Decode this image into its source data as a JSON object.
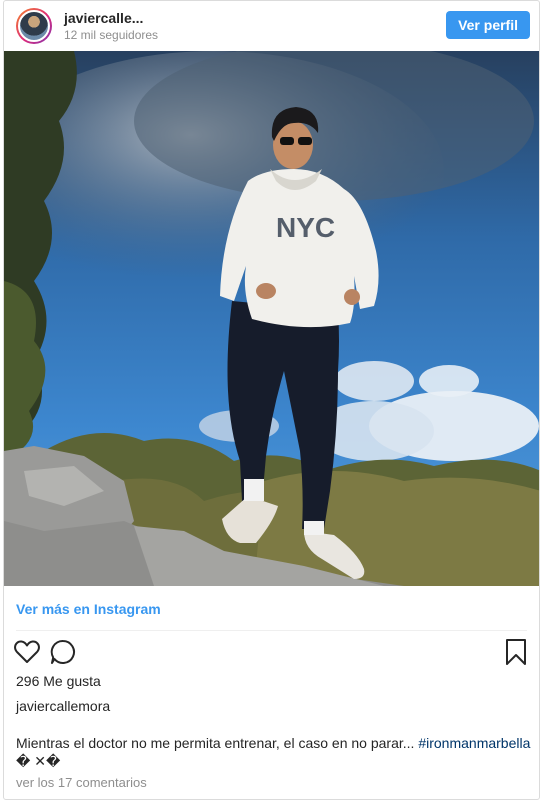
{
  "header": {
    "username": "javiercalle...",
    "followers": "12 mil seguidores",
    "view_profile_label": "Ver perfil"
  },
  "photo": {
    "sweatshirt_text": "NYC"
  },
  "view_more_label": "Ver más en Instagram",
  "actions": {
    "like_icon": "heart-icon",
    "comment_icon": "comment-icon",
    "save_icon": "bookmark-icon"
  },
  "likes": "296 Me gusta",
  "author": "javiercallemora",
  "caption": {
    "text": "Mientras el doctor no me permita entrenar, el caso en no parar... ",
    "hashtag": "#ironmanmarbella",
    "trailing": "� ✕�"
  },
  "comments_label": "ver los 17 comentarios",
  "colors": {
    "accent": "#3897f0",
    "hashtag": "#003569",
    "muted": "#8e8e8e"
  }
}
